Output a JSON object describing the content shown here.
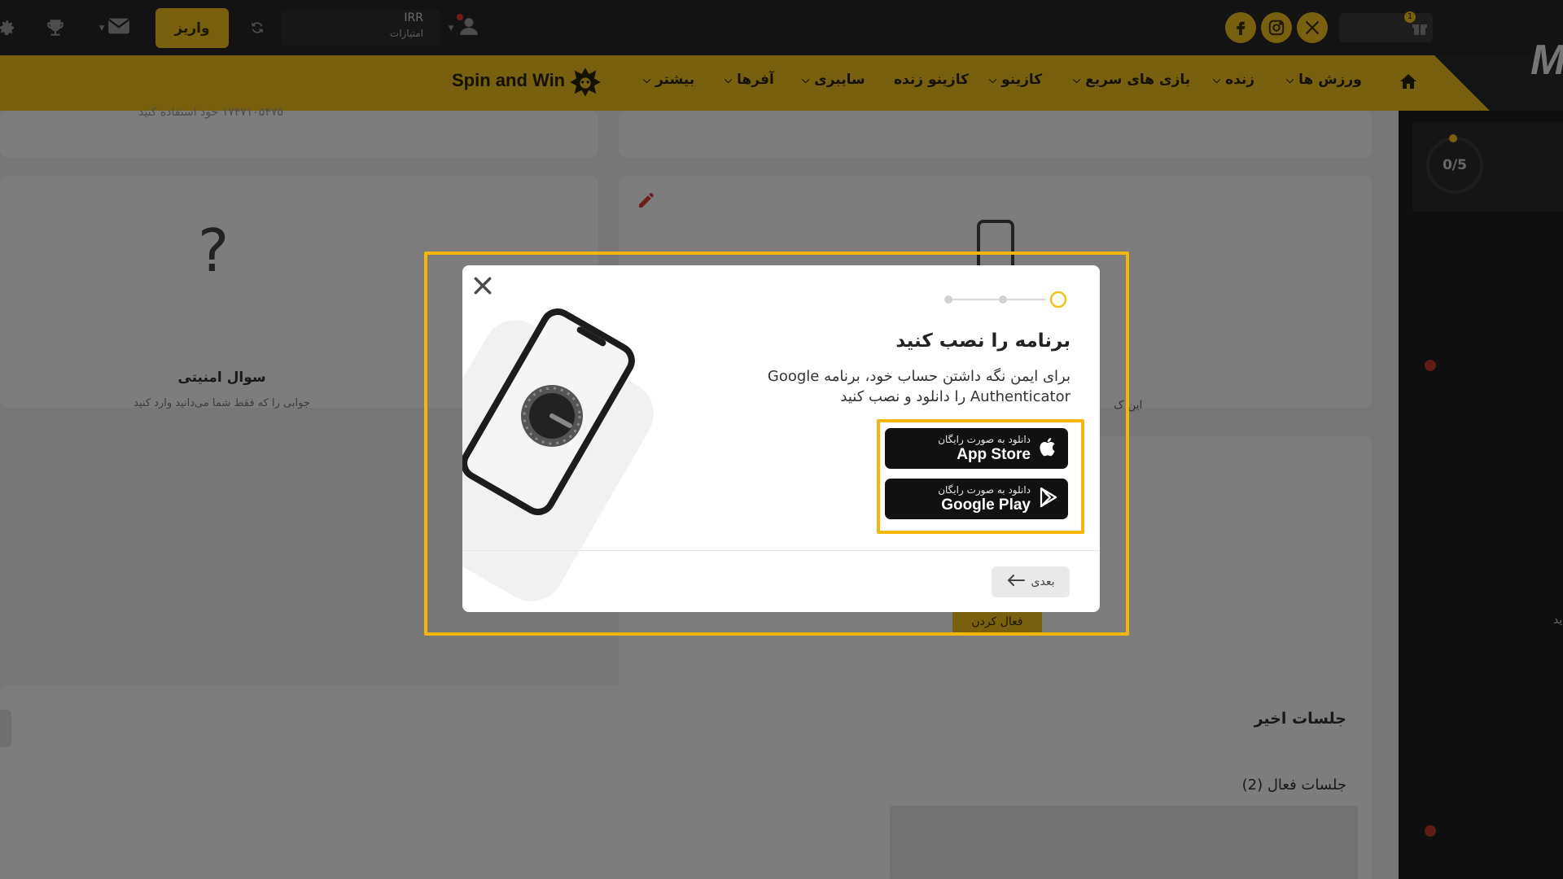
{
  "topbar": {
    "deposit_label": "واریز",
    "balance_currency": "IRR",
    "balance_points_label": "امتیازات",
    "gift_badge": "1"
  },
  "nav": {
    "spin_and_win": "Spin and Win",
    "items": [
      "ورزش ها",
      "زنده",
      "بازی های سریع",
      "کازینو",
      "کازینو زنده",
      "سایبری",
      "آفرها",
      "بیشتر"
    ],
    "logo_fragment": "M"
  },
  "background": {
    "phone_caption": "۱۷۴۷۱۰۵۴۷۵ خود استفاده کنید",
    "security_question_title": "سوال امنیتی",
    "security_question_desc": "جوابی را که فقط شما می‌دانید وارد کنید",
    "side_fragment": "این ک",
    "activate_label": "فعال کردن",
    "recent_sessions": "جلسات اخیر",
    "active_sessions": "جلسات فعال (2)",
    "progress": "0/5",
    "right_fragment": "ید"
  },
  "modal": {
    "title": "برنامه را نصب کنید",
    "desc_line1": "برای ایمن نگه داشتن حساب خود، برنامه Google",
    "desc_line2": "Authenticator را دانلود و نصب کنید",
    "app_store_top": "دانلود به صورت رایگان",
    "app_store_name": "App Store",
    "google_play_top": "دانلود به صورت رایگان",
    "google_play_name": "Google Play",
    "next_label": "بعدی",
    "steps_total": 3,
    "current_step": 3
  },
  "colors": {
    "accent": "#f2c01c",
    "highlight": "#f5b60b",
    "topbar": "#262626",
    "dark_button": "#111111"
  },
  "icons": [
    "gear-icon",
    "trophy-icon",
    "mail-icon",
    "refresh-icon",
    "user-icon",
    "facebook-icon",
    "instagram-icon",
    "x-icon",
    "gift-icon",
    "home-icon",
    "dragon-logo-icon",
    "close-icon",
    "phone-lock-icon",
    "apple-icon",
    "google-play-icon",
    "arrow-left-icon",
    "pencil-icon",
    "question-mark-icon"
  ]
}
